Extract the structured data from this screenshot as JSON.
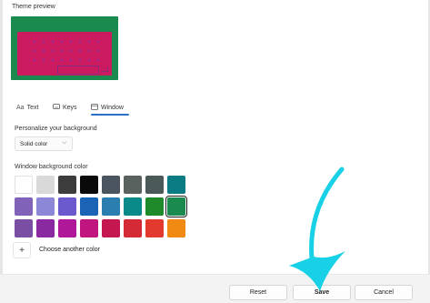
{
  "preview": {
    "label": "Theme preview"
  },
  "tabs": [
    {
      "label": "Text",
      "icon": "Aa"
    },
    {
      "label": "Keys",
      "icon": "keyboard-icon"
    },
    {
      "label": "Window",
      "icon": "window-icon",
      "active": true
    }
  ],
  "background": {
    "label": "Personalize your background",
    "dropdown_value": "Solid color"
  },
  "window_colors": {
    "label": "Window background color",
    "rows": [
      [
        "#ffffff",
        "#d9d9d9",
        "#3c3c3c",
        "#0a0a0a",
        "#4b5560",
        "#59625e",
        "#4b5a58",
        "#0b7c84"
      ],
      [
        "#8062b8",
        "#8c87d6",
        "#6a5acd",
        "#1b63b5",
        "#2a7fb0",
        "#0b8a8a",
        "#1f8a2a",
        "#1b8a4e"
      ],
      [
        "#7a4ea3",
        "#8a2aa0",
        "#b0189a",
        "#c0157e",
        "#c5174f",
        "#d42a36",
        "#e23a2e",
        "#f08a12"
      ]
    ],
    "selected": "#1b8a4e",
    "add_label": "Choose another color"
  },
  "footer": {
    "reset_label": "Reset",
    "save_label": "Save",
    "cancel_label": "Cancel"
  },
  "accent": "#2c6fc6",
  "annotation_color": "#19d1e6"
}
